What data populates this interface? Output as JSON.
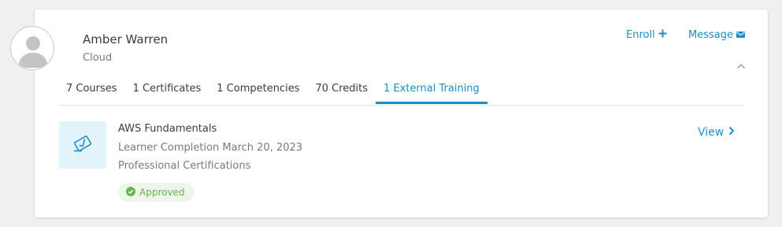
{
  "user": {
    "name": "Amber Warren",
    "department": "Cloud"
  },
  "actions": {
    "enroll_label": "Enroll",
    "message_label": "Message"
  },
  "tabs": [
    {
      "label": "7 Courses",
      "active": false
    },
    {
      "label": "1 Certificates",
      "active": false
    },
    {
      "label": "1 Competencies",
      "active": false
    },
    {
      "label": "70 Credits",
      "active": false
    },
    {
      "label": "1 External Training",
      "active": true
    }
  ],
  "training": {
    "title": "AWS Fundamentals",
    "completion": "Learner Completion March 20, 2023",
    "category": "Professional Certifications",
    "status": "Approved",
    "view_label": "View"
  },
  "icons": {
    "avatar": "user-avatar-icon",
    "enroll": "plus-icon",
    "message": "envelope-icon",
    "collapse": "chevron-up-icon",
    "training": "certificate-check-icon",
    "status": "check-circle-icon",
    "view": "chevron-right-icon"
  },
  "colors": {
    "accent": "#1a8fc8",
    "approved": "#64b450",
    "thumb_bg": "#e3f3fb"
  }
}
